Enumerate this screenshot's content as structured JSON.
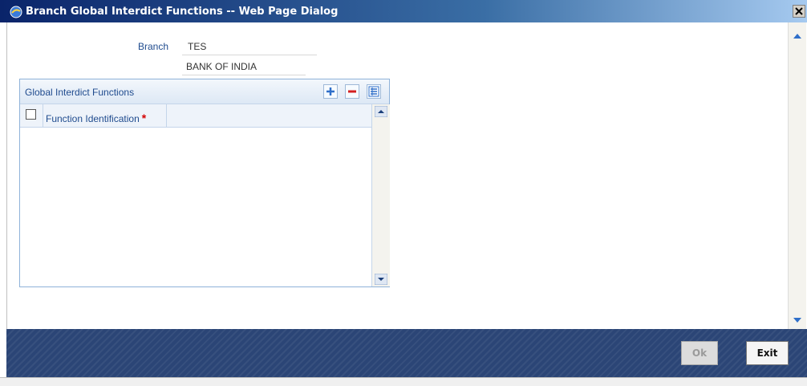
{
  "window": {
    "title": "Branch Global Interdict Functions -- Web Page Dialog",
    "close_icon": "close-icon"
  },
  "branch": {
    "label": "Branch",
    "code": "TES",
    "name": "BANK OF INDIA"
  },
  "panel": {
    "title": "Global Interdict Functions",
    "toolbar_icons": [
      "plus-icon",
      "minus-icon",
      "list-view-icon"
    ],
    "columns": [
      {
        "label": "Function Identification",
        "required_mark": "*"
      }
    ],
    "rows": []
  },
  "footer": {
    "ok_label": "Ok",
    "exit_label": "Exit",
    "ok_enabled": false
  },
  "colors": {
    "title_bar": "#0a246a",
    "label_blue": "#1f4b8e",
    "required_red": "#d40000",
    "footer_blue": "#2b4576",
    "panel_border": "#8fb2d9"
  }
}
